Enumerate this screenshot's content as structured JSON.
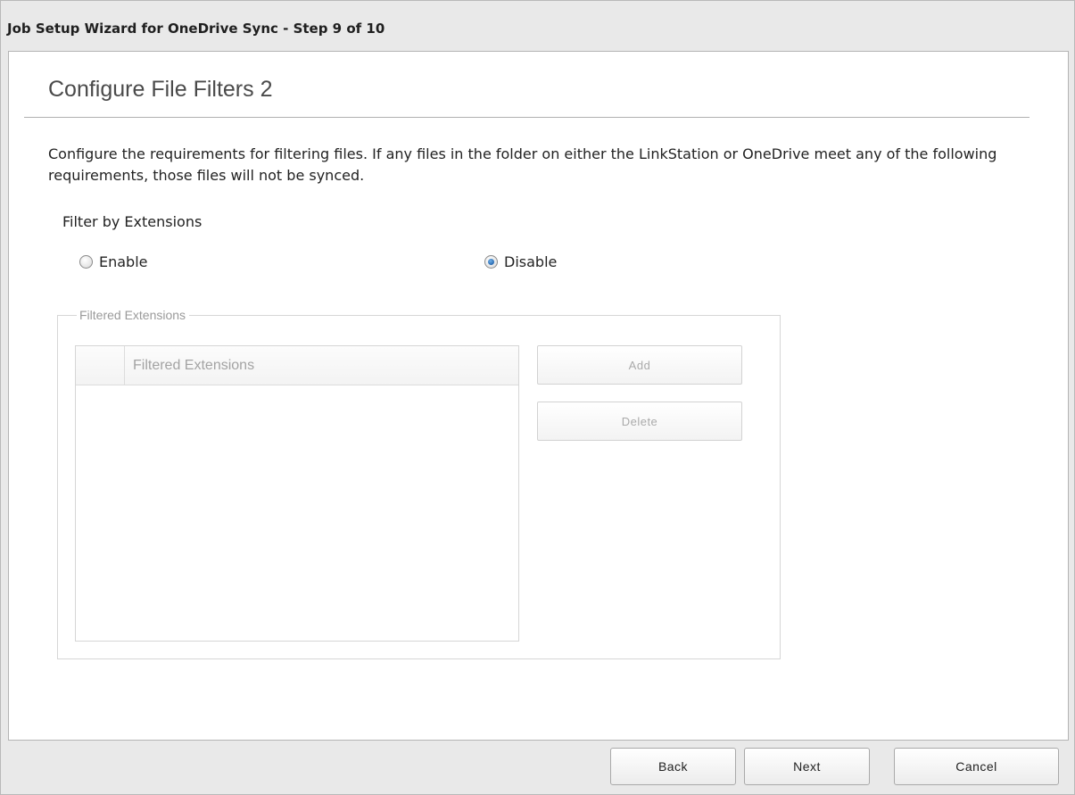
{
  "window": {
    "title": "Job Setup Wizard for OneDrive Sync - Step 9 of 10"
  },
  "page": {
    "heading": "Configure File Filters 2",
    "description": "Configure the requirements for filtering files. If any files in the folder on either the LinkStation or OneDrive meet any of the following requirements, those files will not be synced."
  },
  "filter_extensions": {
    "label": "Filter by Extensions",
    "options": [
      {
        "label": "Enable",
        "selected": false
      },
      {
        "label": "Disable",
        "selected": true
      }
    ]
  },
  "filtered_extensions_group": {
    "legend": "Filtered Extensions",
    "table": {
      "column_header": "Filtered Extensions",
      "rows": []
    },
    "add_label": "Add",
    "delete_label": "Delete",
    "enabled": false
  },
  "footer": {
    "back_label": "Back",
    "next_label": "Next",
    "cancel_label": "Cancel"
  }
}
